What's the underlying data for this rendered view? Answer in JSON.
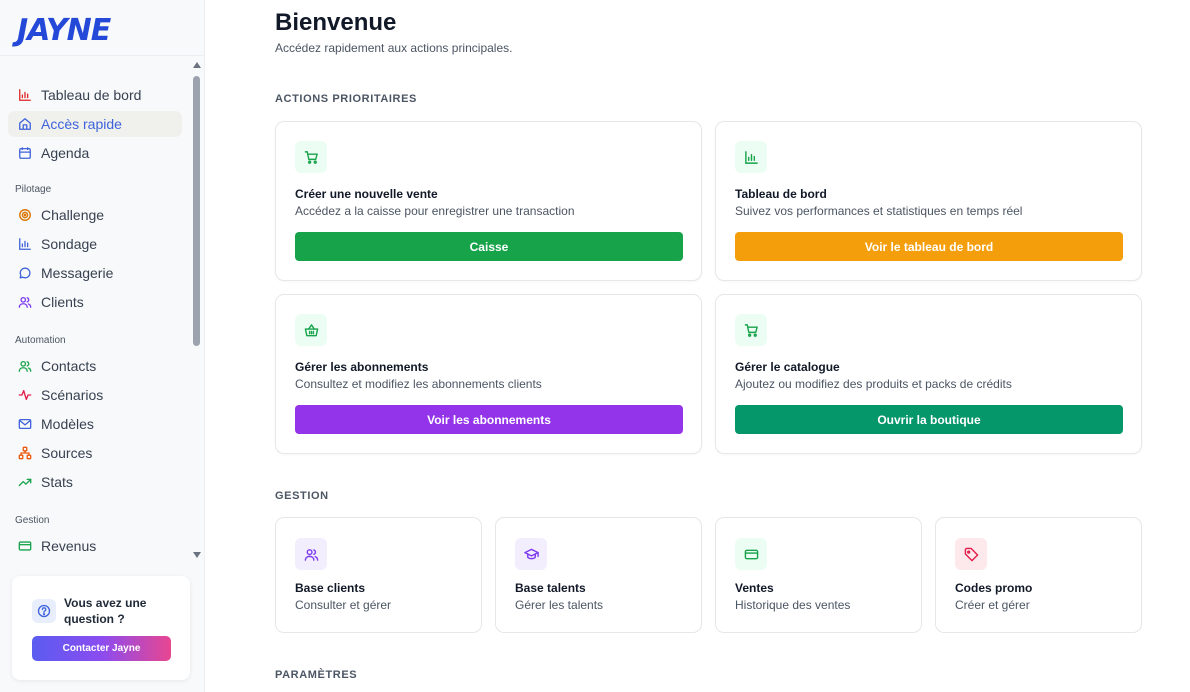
{
  "brand": {
    "logo": "JAYNE",
    "color": "#2449d8"
  },
  "sidebar": {
    "items_top": [
      {
        "label": "Tableau de bord",
        "icon": "bar-chart-icon",
        "active": false
      },
      {
        "label": "Accès rapide",
        "icon": "home-icon",
        "active": true
      },
      {
        "label": "Agenda",
        "icon": "calendar-icon",
        "active": false
      }
    ],
    "section_pilotage": "Pilotage",
    "items_pilotage": [
      {
        "label": "Challenge",
        "icon": "target-icon"
      },
      {
        "label": "Sondage",
        "icon": "bar-chart-icon"
      },
      {
        "label": "Messagerie",
        "icon": "chat-bubble-icon"
      },
      {
        "label": "Clients",
        "icon": "users-icon"
      }
    ],
    "section_automation": "Automation",
    "items_automation": [
      {
        "label": "Contacts",
        "icon": "users-icon"
      },
      {
        "label": "Scénarios",
        "icon": "activity-icon"
      },
      {
        "label": "Modèles",
        "icon": "mail-icon"
      },
      {
        "label": "Sources",
        "icon": "network-icon"
      },
      {
        "label": "Stats",
        "icon": "trending-up-icon"
      }
    ],
    "section_gestion": "Gestion",
    "items_gestion": [
      {
        "label": "Revenus",
        "icon": "credit-card-icon"
      }
    ],
    "help": {
      "text": "Vous avez une question ?",
      "button": "Contacter Jayne"
    }
  },
  "main": {
    "title": "Bienvenue",
    "subtitle": "Accédez rapidement aux actions principales.",
    "section_priority": "ACTIONS PRIORITAIRES",
    "actions": [
      {
        "title": "Créer une nouvelle vente",
        "desc": "Accédez a la caisse pour enregistrer une transaction",
        "button": "Caisse",
        "color": "#16a34a",
        "icon": "shopping-cart-icon"
      },
      {
        "title": "Tableau de bord",
        "desc": "Suivez vos performances et statistiques en temps réel",
        "button": "Voir le tableau de bord",
        "color": "#f59e0b",
        "icon": "bar-chart-icon"
      },
      {
        "title": "Gérer les abonnements",
        "desc": "Consultez et modifiez les abonnements clients",
        "button": "Voir les abonnements",
        "color": "#9333ea",
        "icon": "basket-icon"
      },
      {
        "title": "Gérer le catalogue",
        "desc": "Ajoutez ou modifiez des produits et packs de crédits",
        "button": "Ouvrir la boutique",
        "color": "#059669",
        "icon": "shopping-cart-icon"
      }
    ],
    "section_gestion": "GESTION",
    "management": [
      {
        "title": "Base clients",
        "desc": "Consulter et gérer",
        "icon": "users-icon",
        "icon_color": "#7c3aed",
        "icon_bg": "#f3eefe"
      },
      {
        "title": "Base talents",
        "desc": "Gérer les talents",
        "icon": "graduation-cap-icon",
        "icon_color": "#7c3aed",
        "icon_bg": "#f3eefe"
      },
      {
        "title": "Ventes",
        "desc": "Historique des ventes",
        "icon": "credit-card-icon",
        "icon_color": "#16a34a",
        "icon_bg": "#ecfdf3"
      },
      {
        "title": "Codes promo",
        "desc": "Créer et gérer",
        "icon": "tag-icon",
        "icon_color": "#e11d48",
        "icon_bg": "#fde8ec"
      }
    ],
    "section_parametres": "PARAMÈTRES"
  }
}
